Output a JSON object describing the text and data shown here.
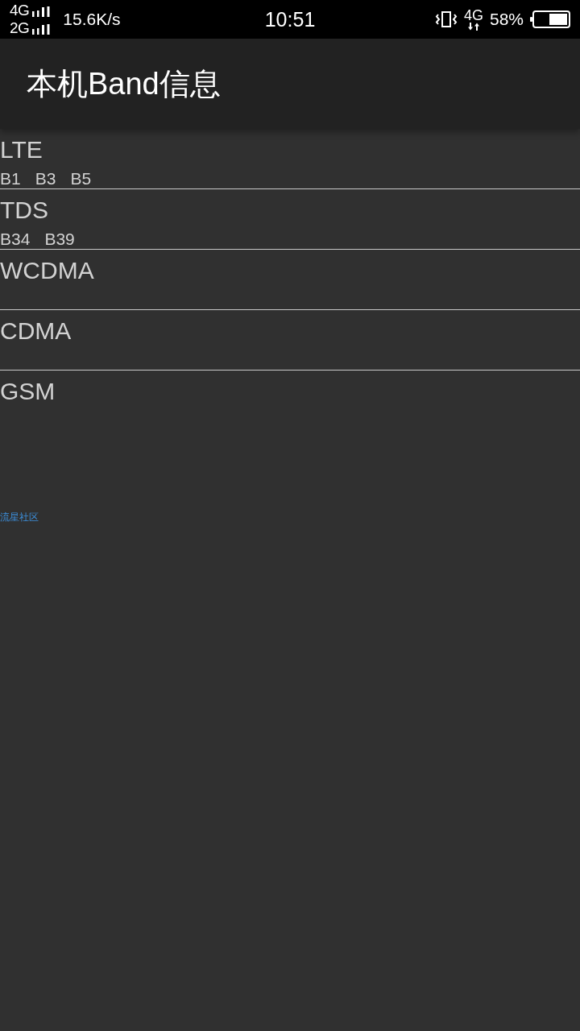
{
  "status_bar": {
    "networks": [
      {
        "label": "4G"
      },
      {
        "label": "2G"
      }
    ],
    "speed": "15.6K/s",
    "time": "10:51",
    "data_network": "4G",
    "battery": "58%"
  },
  "app_bar": {
    "title": "本机Band信息"
  },
  "band_groups": [
    {
      "name": "LTE",
      "bands": [
        "B1",
        "B3",
        "B5"
      ]
    },
    {
      "name": "TDS",
      "bands": [
        "B34",
        "B39"
      ]
    },
    {
      "name": "WCDMA"
    },
    {
      "name": "CDMA"
    },
    {
      "name": "GSM"
    }
  ],
  "footer": {
    "link": "流星社区"
  }
}
